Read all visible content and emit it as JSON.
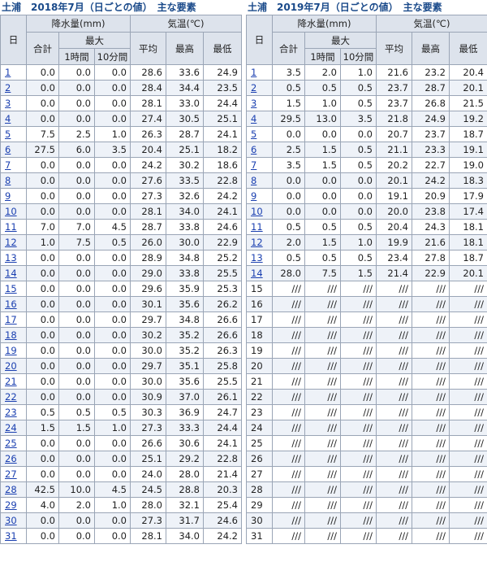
{
  "left": {
    "title": "土浦　2018年7月（日ごとの値）　主な要素",
    "headers": {
      "day": "日",
      "precip": "降水量(mm)",
      "temp": "気温(℃)",
      "total": "合計",
      "max": "最大",
      "hour": "1時間",
      "min10": "10分間",
      "avg": "平均",
      "high": "最高",
      "low": "最低"
    },
    "rows": [
      {
        "day": "1",
        "link": true,
        "vals": [
          "0.0",
          "0.0",
          "0.0",
          "28.6",
          "33.6",
          "24.9"
        ]
      },
      {
        "day": "2",
        "link": true,
        "vals": [
          "0.0",
          "0.0",
          "0.0",
          "28.4",
          "34.4",
          "23.5"
        ]
      },
      {
        "day": "3",
        "link": true,
        "vals": [
          "0.0",
          "0.0",
          "0.0",
          "28.1",
          "33.0",
          "24.4"
        ]
      },
      {
        "day": "4",
        "link": true,
        "vals": [
          "0.0",
          "0.0",
          "0.0",
          "27.4",
          "30.5",
          "25.1"
        ]
      },
      {
        "day": "5",
        "link": true,
        "vals": [
          "7.5",
          "2.5",
          "1.0",
          "26.3",
          "28.7",
          "24.1"
        ]
      },
      {
        "day": "6",
        "link": true,
        "vals": [
          "27.5",
          "6.0",
          "3.5",
          "20.4",
          "25.1",
          "18.2"
        ]
      },
      {
        "day": "7",
        "link": true,
        "vals": [
          "0.0",
          "0.0",
          "0.0",
          "24.2",
          "30.2",
          "18.6"
        ]
      },
      {
        "day": "8",
        "link": true,
        "vals": [
          "0.0",
          "0.0",
          "0.0",
          "27.6",
          "33.5",
          "22.8"
        ]
      },
      {
        "day": "9",
        "link": true,
        "vals": [
          "0.0",
          "0.0",
          "0.0",
          "27.3",
          "32.6",
          "24.2"
        ]
      },
      {
        "day": "10",
        "link": true,
        "vals": [
          "0.0",
          "0.0",
          "0.0",
          "28.1",
          "34.0",
          "24.1"
        ]
      },
      {
        "day": "11",
        "link": true,
        "vals": [
          "7.0",
          "7.0",
          "4.5",
          "28.7",
          "33.8",
          "24.6"
        ]
      },
      {
        "day": "12",
        "link": true,
        "vals": [
          "1.0",
          "7.5",
          "0.5",
          "26.0",
          "30.0",
          "22.9"
        ]
      },
      {
        "day": "13",
        "link": true,
        "vals": [
          "0.0",
          "0.0",
          "0.0",
          "28.9",
          "34.8",
          "25.2"
        ]
      },
      {
        "day": "14",
        "link": true,
        "vals": [
          "0.0",
          "0.0",
          "0.0",
          "29.0",
          "33.8",
          "25.5"
        ]
      },
      {
        "day": "15",
        "link": true,
        "vals": [
          "0.0",
          "0.0",
          "0.0",
          "29.6",
          "35.9",
          "25.3"
        ]
      },
      {
        "day": "16",
        "link": true,
        "vals": [
          "0.0",
          "0.0",
          "0.0",
          "30.1",
          "35.6",
          "26.2"
        ]
      },
      {
        "day": "17",
        "link": true,
        "vals": [
          "0.0",
          "0.0",
          "0.0",
          "29.7",
          "34.8",
          "26.6"
        ]
      },
      {
        "day": "18",
        "link": true,
        "vals": [
          "0.0",
          "0.0",
          "0.0",
          "30.2",
          "35.2",
          "26.6"
        ]
      },
      {
        "day": "19",
        "link": true,
        "vals": [
          "0.0",
          "0.0",
          "0.0",
          "30.0",
          "35.2",
          "26.3"
        ]
      },
      {
        "day": "20",
        "link": true,
        "vals": [
          "0.0",
          "0.0",
          "0.0",
          "29.7",
          "35.1",
          "25.8"
        ]
      },
      {
        "day": "21",
        "link": true,
        "vals": [
          "0.0",
          "0.0",
          "0.0",
          "30.0",
          "35.6",
          "25.5"
        ]
      },
      {
        "day": "22",
        "link": true,
        "vals": [
          "0.0",
          "0.0",
          "0.0",
          "30.9",
          "37.0",
          "26.1"
        ]
      },
      {
        "day": "23",
        "link": true,
        "vals": [
          "0.5",
          "0.5",
          "0.5",
          "30.3",
          "36.9",
          "24.7"
        ]
      },
      {
        "day": "24",
        "link": true,
        "vals": [
          "1.5",
          "1.5",
          "1.0",
          "27.3",
          "33.3",
          "24.4"
        ]
      },
      {
        "day": "25",
        "link": true,
        "vals": [
          "0.0",
          "0.0",
          "0.0",
          "26.6",
          "30.6",
          "24.1"
        ]
      },
      {
        "day": "26",
        "link": true,
        "vals": [
          "0.0",
          "0.0",
          "0.0",
          "25.1",
          "29.2",
          "22.8"
        ]
      },
      {
        "day": "27",
        "link": true,
        "vals": [
          "0.0",
          "0.0",
          "0.0",
          "24.0",
          "28.0",
          "21.4"
        ]
      },
      {
        "day": "28",
        "link": true,
        "vals": [
          "42.5",
          "10.0",
          "4.5",
          "24.5",
          "28.8",
          "20.3"
        ]
      },
      {
        "day": "29",
        "link": true,
        "vals": [
          "4.0",
          "2.0",
          "1.0",
          "28.0",
          "32.1",
          "25.4"
        ]
      },
      {
        "day": "30",
        "link": true,
        "vals": [
          "0.0",
          "0.0",
          "0.0",
          "27.3",
          "31.7",
          "24.6"
        ]
      },
      {
        "day": "31",
        "link": true,
        "vals": [
          "0.0",
          "0.0",
          "0.0",
          "28.1",
          "34.0",
          "24.2"
        ]
      }
    ]
  },
  "right": {
    "title": "土浦　2019年7月（日ごとの値）　主な要素",
    "headers": {
      "day": "日",
      "precip": "降水量(mm)",
      "temp": "気温(℃)",
      "total": "合計",
      "max": "最大",
      "hour": "1時間",
      "min10": "10分間",
      "avg": "平均",
      "high": "最高",
      "low": "最低"
    },
    "rows": [
      {
        "day": "1",
        "link": true,
        "vals": [
          "3.5",
          "2.0",
          "1.0",
          "21.6",
          "23.2",
          "20.4"
        ]
      },
      {
        "day": "2",
        "link": true,
        "vals": [
          "0.5",
          "0.5",
          "0.5",
          "23.7",
          "28.7",
          "20.1"
        ]
      },
      {
        "day": "3",
        "link": true,
        "vals": [
          "1.5",
          "1.0",
          "0.5",
          "23.7",
          "26.8",
          "21.5"
        ]
      },
      {
        "day": "4",
        "link": true,
        "vals": [
          "29.5",
          "13.0",
          "3.5",
          "21.8",
          "24.9",
          "19.2"
        ]
      },
      {
        "day": "5",
        "link": true,
        "vals": [
          "0.0",
          "0.0",
          "0.0",
          "20.7",
          "23.7",
          "18.7"
        ]
      },
      {
        "day": "6",
        "link": true,
        "vals": [
          "2.5",
          "1.5",
          "0.5",
          "21.1",
          "23.3",
          "19.1"
        ]
      },
      {
        "day": "7",
        "link": true,
        "vals": [
          "3.5",
          "1.5",
          "0.5",
          "20.2",
          "22.7",
          "19.0"
        ]
      },
      {
        "day": "8",
        "link": true,
        "vals": [
          "0.0",
          "0.0",
          "0.0",
          "20.1",
          "24.2",
          "18.3"
        ]
      },
      {
        "day": "9",
        "link": true,
        "vals": [
          "0.0",
          "0.0",
          "0.0",
          "19.1",
          "20.9",
          "17.9"
        ]
      },
      {
        "day": "10",
        "link": true,
        "vals": [
          "0.0",
          "0.0",
          "0.0",
          "20.0",
          "23.8",
          "17.4"
        ]
      },
      {
        "day": "11",
        "link": true,
        "vals": [
          "0.5",
          "0.5",
          "0.5",
          "20.4",
          "24.3",
          "18.1"
        ]
      },
      {
        "day": "12",
        "link": true,
        "vals": [
          "2.0",
          "1.5",
          "1.0",
          "19.9",
          "21.6",
          "18.1"
        ]
      },
      {
        "day": "13",
        "link": true,
        "vals": [
          "0.5",
          "0.5",
          "0.5",
          "23.4",
          "27.8",
          "18.7"
        ]
      },
      {
        "day": "14",
        "link": true,
        "vals": [
          "28.0",
          "7.5",
          "1.5",
          "21.4",
          "22.9",
          "20.1"
        ]
      },
      {
        "day": "15",
        "link": false,
        "vals": [
          "///",
          "///",
          "///",
          "///",
          "///",
          "///"
        ]
      },
      {
        "day": "16",
        "link": false,
        "vals": [
          "///",
          "///",
          "///",
          "///",
          "///",
          "///"
        ]
      },
      {
        "day": "17",
        "link": false,
        "vals": [
          "///",
          "///",
          "///",
          "///",
          "///",
          "///"
        ]
      },
      {
        "day": "18",
        "link": false,
        "vals": [
          "///",
          "///",
          "///",
          "///",
          "///",
          "///"
        ]
      },
      {
        "day": "19",
        "link": false,
        "vals": [
          "///",
          "///",
          "///",
          "///",
          "///",
          "///"
        ]
      },
      {
        "day": "20",
        "link": false,
        "vals": [
          "///",
          "///",
          "///",
          "///",
          "///",
          "///"
        ]
      },
      {
        "day": "21",
        "link": false,
        "vals": [
          "///",
          "///",
          "///",
          "///",
          "///",
          "///"
        ]
      },
      {
        "day": "22",
        "link": false,
        "vals": [
          "///",
          "///",
          "///",
          "///",
          "///",
          "///"
        ]
      },
      {
        "day": "23",
        "link": false,
        "vals": [
          "///",
          "///",
          "///",
          "///",
          "///",
          "///"
        ]
      },
      {
        "day": "24",
        "link": false,
        "vals": [
          "///",
          "///",
          "///",
          "///",
          "///",
          "///"
        ]
      },
      {
        "day": "25",
        "link": false,
        "vals": [
          "///",
          "///",
          "///",
          "///",
          "///",
          "///"
        ]
      },
      {
        "day": "26",
        "link": false,
        "vals": [
          "///",
          "///",
          "///",
          "///",
          "///",
          "///"
        ]
      },
      {
        "day": "27",
        "link": false,
        "vals": [
          "///",
          "///",
          "///",
          "///",
          "///",
          "///"
        ]
      },
      {
        "day": "28",
        "link": false,
        "vals": [
          "///",
          "///",
          "///",
          "///",
          "///",
          "///"
        ]
      },
      {
        "day": "29",
        "link": false,
        "vals": [
          "///",
          "///",
          "///",
          "///",
          "///",
          "///"
        ]
      },
      {
        "day": "30",
        "link": false,
        "vals": [
          "///",
          "///",
          "///",
          "///",
          "///",
          "///"
        ]
      },
      {
        "day": "31",
        "link": false,
        "vals": [
          "///",
          "///",
          "///",
          "///",
          "///",
          "///"
        ]
      }
    ]
  }
}
